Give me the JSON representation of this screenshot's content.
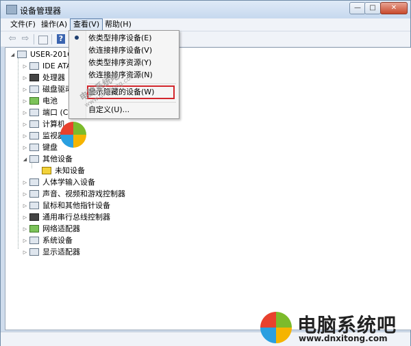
{
  "window": {
    "title": "设备管理器"
  },
  "title_controls": {
    "minimize": "—",
    "maximize": "□",
    "close": "✕"
  },
  "menubar": [
    {
      "label": "文件(F)"
    },
    {
      "label": "操作(A)"
    },
    {
      "label": "查看(V)"
    },
    {
      "label": "帮助(H)"
    }
  ],
  "tree": {
    "root": "USER-20160",
    "items": [
      {
        "label": "IDE ATA",
        "icon": "ide-icon"
      },
      {
        "label": "处理器",
        "icon": "processor-icon"
      },
      {
        "label": "磁盘驱动",
        "icon": "disk-icon"
      },
      {
        "label": "电池",
        "icon": "battery-icon"
      },
      {
        "label": "端口 (CO",
        "icon": "port-icon"
      },
      {
        "label": "计算机",
        "icon": "computer-icon"
      },
      {
        "label": "监视器",
        "icon": "monitor-icon"
      },
      {
        "label": "键盘",
        "icon": "keyboard-icon"
      },
      {
        "label": "其他设备",
        "icon": "other-devices-icon"
      },
      {
        "label": "未知设备",
        "icon": "unknown-device-icon"
      },
      {
        "label": "人体学输入设备",
        "icon": "hid-icon"
      },
      {
        "label": "声音、视频和游戏控制器",
        "icon": "sound-icon"
      },
      {
        "label": "鼠标和其他指针设备",
        "icon": "mouse-icon"
      },
      {
        "label": "通用串行总线控制器",
        "icon": "usb-icon"
      },
      {
        "label": "网络适配器",
        "icon": "network-icon"
      },
      {
        "label": "系统设备",
        "icon": "system-icon"
      },
      {
        "label": "显示适配器",
        "icon": "display-icon"
      }
    ]
  },
  "view_menu": {
    "items": [
      {
        "label": "依类型排序设备(E)",
        "selected": true
      },
      {
        "label": "依连接排序设备(V)"
      },
      {
        "label": "依类型排序资源(Y)"
      },
      {
        "label": "依连接排序资源(N)"
      },
      {
        "label": "显示隐藏的设备(W)",
        "highlighted": true
      },
      {
        "label": "自定义(U)..."
      }
    ]
  },
  "watermark": {
    "diagonal_text": "电脑系统吧",
    "diagonal_url": "www.dnxitong.com",
    "brand": "电脑系统吧",
    "url": "www.dnxitong.com"
  },
  "colors": {
    "highlight_box": "#d2252b",
    "logo_red": "#e8412d",
    "logo_green": "#7cbb2b",
    "logo_blue": "#2a9fe0",
    "logo_yellow": "#f5b400"
  }
}
